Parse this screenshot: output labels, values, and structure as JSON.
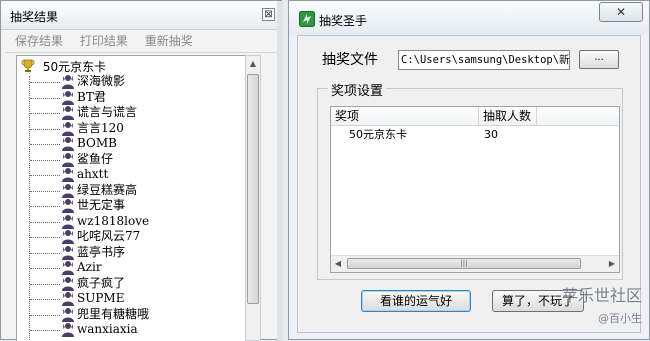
{
  "left_window": {
    "title": "抽奖结果",
    "close_glyph": "⊠",
    "menu": [
      "保存结果",
      "打印结果",
      "重新抽奖"
    ],
    "tree": {
      "root": "50元京东卡",
      "items": [
        "深海微影",
        "BT君",
        "谎言与谎言",
        "言言120",
        "BOMB",
        "鲨鱼仔",
        "ahxtt",
        "绿豆糕赛高",
        "世无定事",
        "wz1818love",
        "叱咤风云77",
        "蓝亭书序",
        "Azir",
        "疯子疯了",
        "SUPME",
        "兜里有糖糖哦",
        "wanxiaxia"
      ]
    }
  },
  "right_window": {
    "title": "抽奖圣手",
    "close_glyph": "✕",
    "file_label": "抽奖文件",
    "file_path": "C:\\Users\\samsung\\Desktop\\新建",
    "browse_label": "...",
    "group_label": "奖项设置",
    "table": {
      "columns": [
        "奖项",
        "抽取人数"
      ],
      "rows": [
        [
          "50元京东卡",
          "30"
        ]
      ]
    },
    "draw_button": "看谁的运气好",
    "quit_button": "算了，不玩了"
  },
  "watermark": {
    "line1": "苹乐世社区",
    "line2": "@百小生"
  },
  "colors": {
    "accent": "#3c7fb1",
    "app_icon": "#2e9b3b"
  }
}
